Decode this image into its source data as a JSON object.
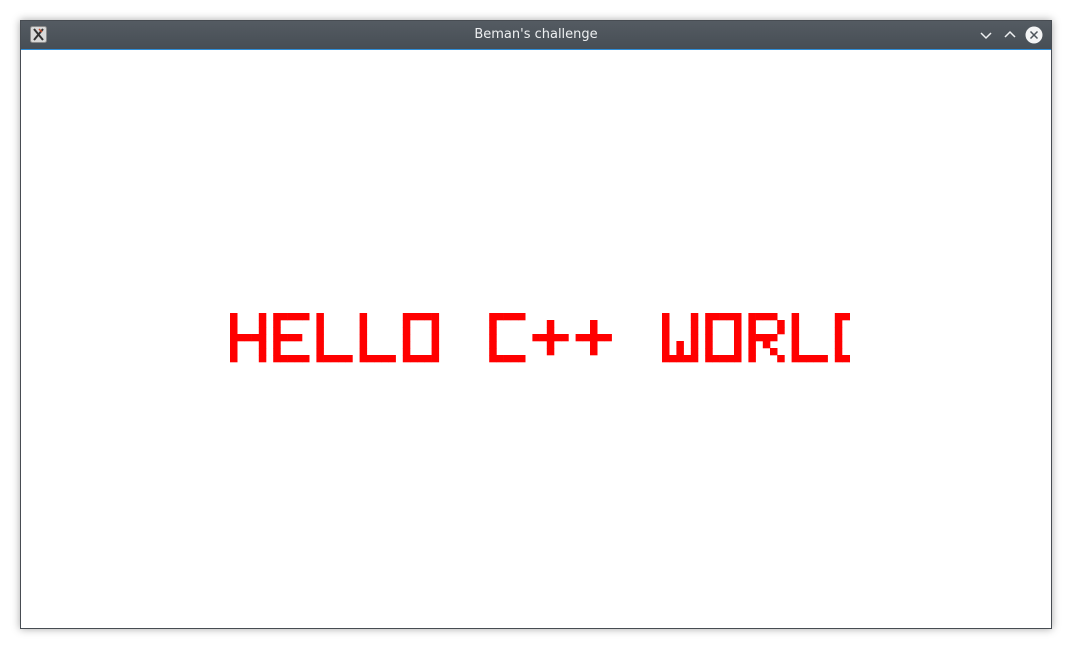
{
  "window": {
    "title": "Beman's challenge",
    "app_icon": "x-app-icon",
    "controls": {
      "minimize_icon": "chevron-down-icon",
      "maximize_icon": "chevron-up-icon",
      "close_icon": "close-icon"
    }
  },
  "content": {
    "text": "HELLO C++ WORLD",
    "text_color": "#ff0000",
    "background": "#ffffff"
  },
  "colors": {
    "titlebar": "#4d545b",
    "title_text": "#eef0f2",
    "accent": "#2f8ed8"
  }
}
